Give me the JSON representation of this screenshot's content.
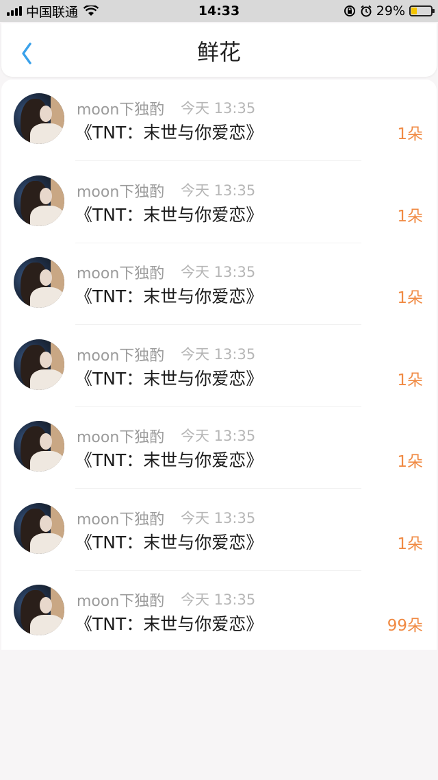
{
  "status_bar": {
    "carrier": "中国联通",
    "time": "14:33",
    "battery": "29%",
    "battery_level": 0.29
  },
  "header": {
    "title": "鲜花",
    "back_icon": "chevron-left-icon"
  },
  "colors": {
    "accent_count": "#f08a43",
    "back_icon": "#3aa1ea"
  },
  "records": [
    {
      "user": "moon下独酌",
      "time": "今天 13:35",
      "book": "《TNT：末世与你爱恋》",
      "count": "1朵"
    },
    {
      "user": "moon下独酌",
      "time": "今天 13:35",
      "book": "《TNT：末世与你爱恋》",
      "count": "1朵"
    },
    {
      "user": "moon下独酌",
      "time": "今天 13:35",
      "book": "《TNT：末世与你爱恋》",
      "count": "1朵"
    },
    {
      "user": "moon下独酌",
      "time": "今天 13:35",
      "book": "《TNT：末世与你爱恋》",
      "count": "1朵"
    },
    {
      "user": "moon下独酌",
      "time": "今天 13:35",
      "book": "《TNT：末世与你爱恋》",
      "count": "1朵"
    },
    {
      "user": "moon下独酌",
      "time": "今天 13:35",
      "book": "《TNT：末世与你爱恋》",
      "count": "1朵"
    },
    {
      "user": "moon下独酌",
      "time": "今天 13:35",
      "book": "《TNT：末世与你爱恋》",
      "count": "99朵"
    }
  ]
}
